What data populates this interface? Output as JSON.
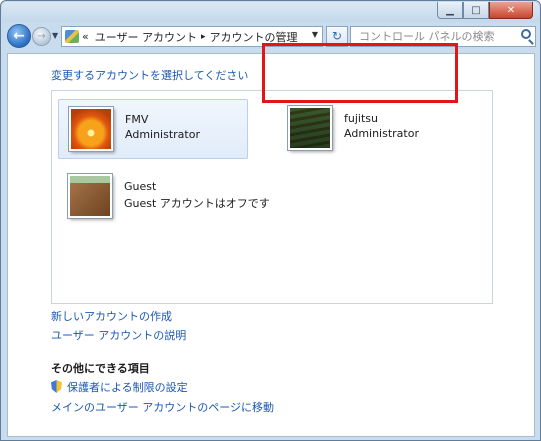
{
  "window": {
    "buttons": {
      "minimize": "▁",
      "maximize": "□",
      "close": "✕"
    }
  },
  "nav": {
    "back_glyph": "←",
    "forward_glyph": "→",
    "breadcrumb_prefix": "«",
    "breadcrumb": [
      "ユーザー アカウント",
      "アカウントの管理"
    ],
    "crumb_separator": "▸",
    "refresh_glyph": "↻",
    "search_placeholder": "コントロール パネルの検索"
  },
  "main": {
    "prompt": "変更するアカウントを選択してください",
    "accounts": [
      {
        "name": "FMV",
        "type": "Administrator",
        "picture": "flower",
        "hover": true
      },
      {
        "name": "fujitsu",
        "type": "Administrator",
        "picture": "stairs",
        "highlighted": true
      },
      {
        "name": "Guest",
        "type": "Guest アカウントはオフです",
        "picture": "briefcase"
      }
    ],
    "links": {
      "create_account": "新しいアカウントの作成",
      "about_accounts": "ユーザー アカウントの説明"
    },
    "other": {
      "title": "その他にできる項目",
      "parental_controls": "保護者による制限の設定",
      "main_page": "メインのユーザー アカウントのページに移動"
    }
  },
  "colors": {
    "link": "#1a58b4",
    "highlight_border": "#e31515",
    "frame": "#c8dcee"
  }
}
